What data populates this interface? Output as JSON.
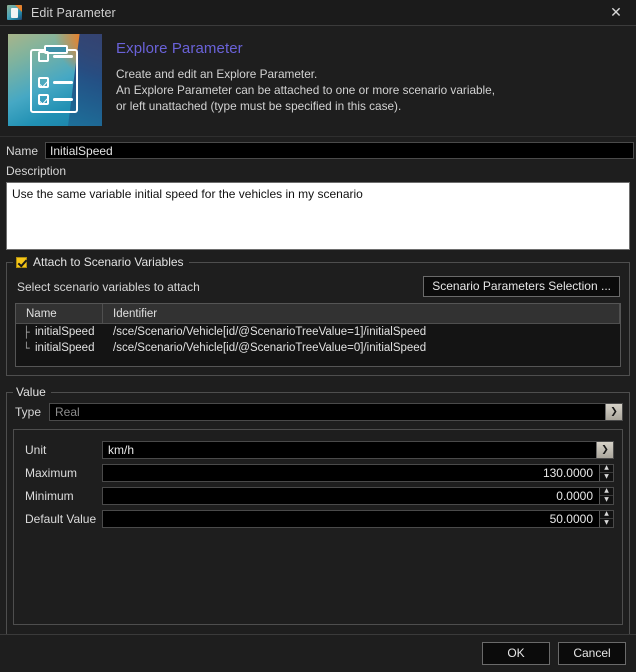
{
  "window": {
    "title": "Edit Parameter",
    "icon": "clipboard-icon",
    "close_label": "✕"
  },
  "banner": {
    "icon": "clipboard-checklist-icon",
    "title": "Explore Parameter",
    "description_line1": "Create and edit an Explore Parameter.",
    "description_line2": "An Explore Parameter can be attached to one or more scenario variable,",
    "description_line3": "or left unattached (type must be specified in this case).",
    "title_color": "#6a62d8"
  },
  "name_field": {
    "label": "Name",
    "value": "InitialSpeed",
    "placeholder": ""
  },
  "description_field": {
    "label": "Description",
    "value": "Use the same variable initial speed for the vehicles in my scenario",
    "placeholder": ""
  },
  "attach_group": {
    "checkbox_checked": true,
    "checkbox_color": "#f5c518",
    "title": "Attach to Scenario Variables",
    "instruction": "Select scenario variables to attach",
    "selection_button": "Scenario Parameters Selection ...",
    "table": {
      "columns": [
        "Name",
        "Identifier"
      ],
      "rows": [
        {
          "tree": "├",
          "name": "initialSpeed",
          "identifier": "/sce/Scenario/Vehicle[id/@ScenarioTreeValue=1]/initialSpeed"
        },
        {
          "tree": "└",
          "name": "initialSpeed",
          "identifier": "/sce/Scenario/Vehicle[id/@ScenarioTreeValue=0]/initialSpeed"
        }
      ]
    }
  },
  "value_group": {
    "title": "Value",
    "type": {
      "label": "Type",
      "value": "Real",
      "disabled": true
    },
    "unit": {
      "label": "Unit",
      "value": "km/h"
    },
    "maximum": {
      "label": "Maximum",
      "value": "130.0000"
    },
    "minimum": {
      "label": "Minimum",
      "value": "0.0000"
    },
    "default_value": {
      "label": "Default Value",
      "value": "50.0000"
    },
    "spinner_up": "▲",
    "spinner_down": "▼",
    "dropdown_arrow": "❯"
  },
  "footer": {
    "ok_label": "OK",
    "cancel_label": "Cancel"
  }
}
